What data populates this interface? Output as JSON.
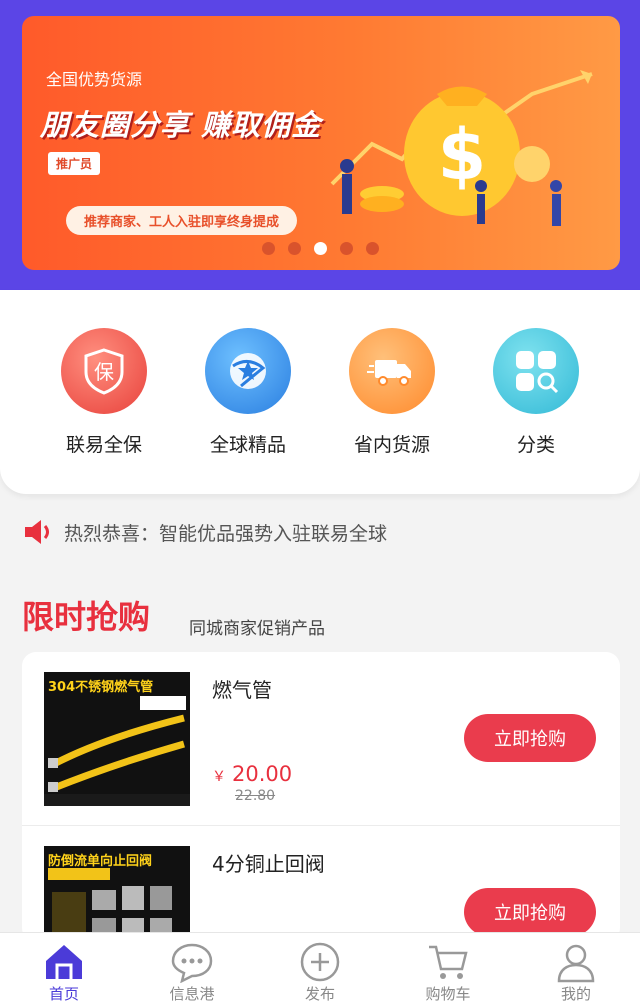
{
  "banner": {
    "tagline": "全国优势货源",
    "headline": "朋友圈分享  赚取佣金",
    "badge": "推广员",
    "pill": "推荐商家、工人入驻即享终身提成",
    "dots": 5,
    "active_dot": 3
  },
  "categories": [
    {
      "label": "联易全保",
      "icon": "shield-bao-icon"
    },
    {
      "label": "全球精品",
      "icon": "globe-star-icon"
    },
    {
      "label": "省内货源",
      "icon": "truck-icon"
    },
    {
      "label": "分类",
      "icon": "grid-search-icon"
    }
  ],
  "notice": {
    "text": "热烈恭喜：智能优品强势入驻联易全球"
  },
  "flash_sale": {
    "title": "限时抢购",
    "subtitle": "同城商家促销产品"
  },
  "products": [
    {
      "name": "燃气管",
      "currency": "￥",
      "price": "20.00",
      "original_price": "22.80",
      "button": "立即抢购",
      "thumb_title": "304不锈钢燃气管"
    },
    {
      "name": "4分铜止回阀",
      "currency": "",
      "price": "",
      "original_price": "",
      "button": "立即抢购",
      "thumb_title": "防倒流单向止回阀"
    }
  ],
  "tabs": [
    {
      "label": "首页",
      "icon": "home-icon",
      "active": true
    },
    {
      "label": "信息港",
      "icon": "chat-bubble-icon",
      "active": false
    },
    {
      "label": "发布",
      "icon": "plus-circle-icon",
      "active": false
    },
    {
      "label": "购物车",
      "icon": "cart-icon",
      "active": false
    },
    {
      "label": "我的",
      "icon": "user-icon",
      "active": false
    }
  ],
  "colors": {
    "primary": "#5b45e6",
    "accent_red": "#e8303e",
    "banner_orange": "#ff6a2e"
  }
}
